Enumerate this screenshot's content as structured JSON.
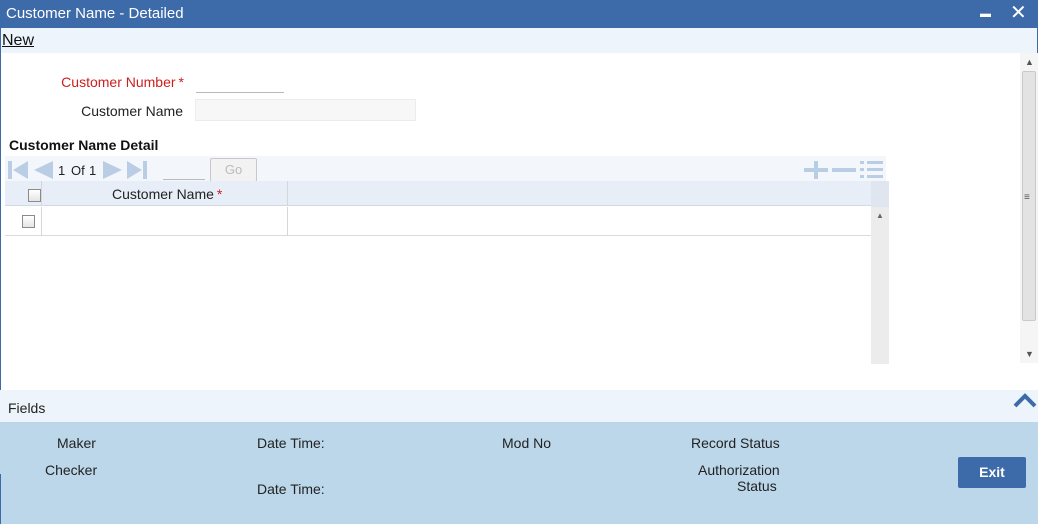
{
  "window": {
    "title": "Customer Name - Detailed",
    "minimize_glyph": "▬",
    "close_glyph": "✕"
  },
  "menu": {
    "new_label": "New"
  },
  "form": {
    "customer_number_label": "Customer Number",
    "customer_number_required": "*",
    "customer_number_value": "",
    "customer_name_label": "Customer Name",
    "customer_name_value": ""
  },
  "detail_section": {
    "title": "Customer Name Detail",
    "pager": {
      "current": "1",
      "of_label": "Of",
      "total": "1",
      "go_label": "Go"
    },
    "columns": [
      {
        "label": "Customer Name",
        "required": "*"
      }
    ],
    "rows": [
      {
        "customer_name": ""
      }
    ]
  },
  "fields_bar": {
    "label": "Fields"
  },
  "footer": {
    "maker_label": "Maker",
    "checker_label": "Checker",
    "date_time_label_1": "Date Time:",
    "date_time_label_2": "Date Time:",
    "mod_no_label": "Mod No",
    "record_status_label": "Record Status",
    "authorization_label_line1": "Authorization",
    "authorization_label_line2": "Status",
    "exit_label": "Exit"
  },
  "colors": {
    "title_bar": "#3d6aa8",
    "required_text": "#cc1f1f",
    "footer_bg": "#bcd7ea",
    "exit_button": "#3d6aa8"
  },
  "icons": [
    "first-page-icon",
    "prev-page-icon",
    "next-page-icon",
    "last-page-icon",
    "add-row-icon",
    "delete-row-icon",
    "single-view-icon",
    "collapse-chevron-icon"
  ]
}
